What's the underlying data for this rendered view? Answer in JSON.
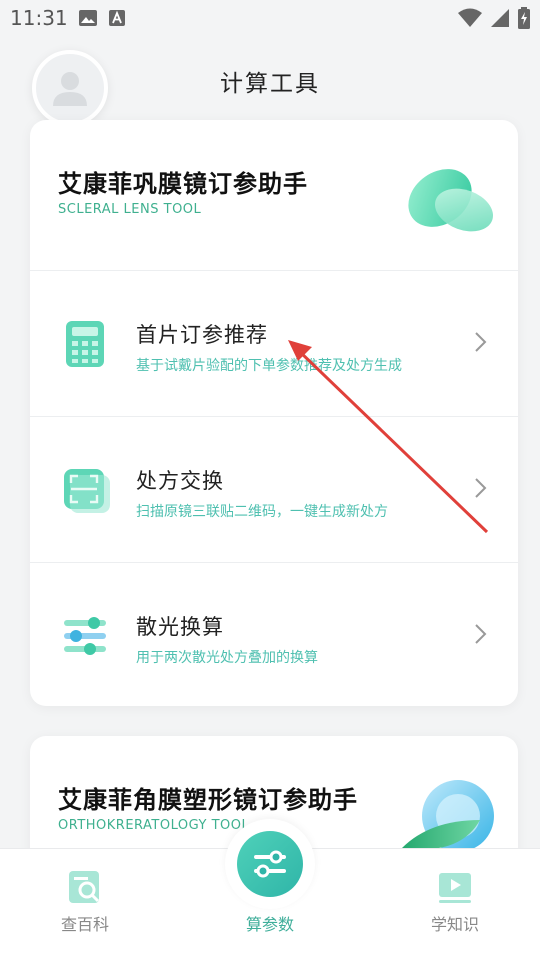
{
  "status_bar": {
    "time": "11:31",
    "icons": [
      "image-icon",
      "font-icon",
      "wifi-icon",
      "signal-icon",
      "battery-charging-icon"
    ]
  },
  "header": {
    "title": "计算工具",
    "avatar_icon": "user-avatar-icon"
  },
  "scleral_card": {
    "title": "艾康菲巩膜镜订参助手",
    "subtitle": "SCLERAL LENS TOOL",
    "hero_icon": "scleral-lens-illustration",
    "items": [
      {
        "label": "首片订参推荐",
        "desc": "基于试戴片验配的下单参数推荐及处方生成",
        "icon": "calculator-icon"
      },
      {
        "label": "处方交换",
        "desc": "扫描原镜三联贴二维码，一键生成新处方",
        "icon": "qr-scan-icon"
      },
      {
        "label": "散光换算",
        "desc": "用于两次散光处方叠加的换算",
        "icon": "sliders-icon"
      }
    ]
  },
  "ortho_card": {
    "title": "艾康菲角膜塑形镜订参助手",
    "subtitle": "ORTHOKRERATOLOGY TOOL",
    "hero_icon": "ortho-lens-illustration"
  },
  "bottom_nav": {
    "left": {
      "label": "查百科",
      "icon": "search-book-icon"
    },
    "center": {
      "label": "算参数",
      "icon": "sliders-icon"
    },
    "right": {
      "label": "学知识",
      "icon": "video-play-icon"
    }
  },
  "colors": {
    "accent": "#3fb08f",
    "desc_text": "#4fc0b0",
    "annotation_arrow": "#e0403a"
  }
}
